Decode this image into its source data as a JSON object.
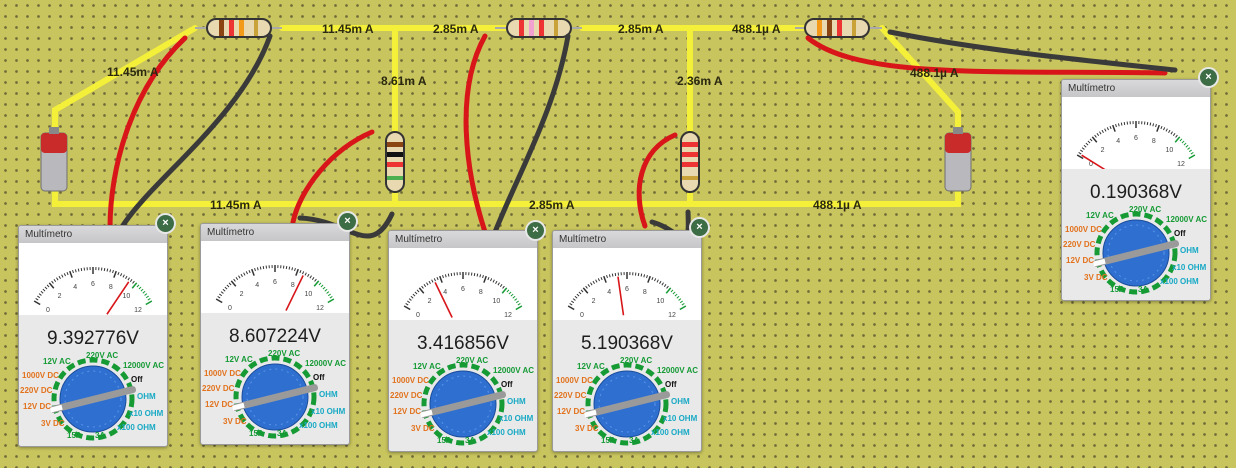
{
  "current_labels": [
    "11.45m A",
    "11.45m A",
    "8.61m A",
    "2.85m A",
    "2.85m A",
    "2.36m A",
    "488.1µ A",
    "488.1µ A",
    "11.45m A",
    "2.85m A",
    "488.1µ A"
  ],
  "meter": {
    "title": "Multímetro",
    "close_icon": "×",
    "scale_ticks": [
      "0",
      "2",
      "4",
      "6",
      "8",
      "10",
      "12"
    ],
    "range_labels": {
      "ac_12": "12V AC",
      "ac_220": "220V AC",
      "ac_12000": "12000V AC",
      "off": "Off",
      "ohm": "OHM",
      "ohm_x10": "x10 OHM",
      "ohm_x100": "x100 OHM",
      "dc_1000": "1000V DC",
      "dc_220": "220V DC",
      "dc_12": "12V DC",
      "dc_3": "3V DC",
      "a_15": "15A",
      "a_3": "3A"
    }
  },
  "meters": [
    {
      "reading": "9.392776V",
      "needle": 9.39
    },
    {
      "reading": "8.607224V",
      "needle": 8.61
    },
    {
      "reading": "3.416856V",
      "needle": 3.42
    },
    {
      "reading": "5.190368V",
      "needle": 5.19
    },
    {
      "reading": "0.190368V",
      "needle": 0.19
    }
  ],
  "colors": {
    "wire": "#f4f03a",
    "probe_positive": "#d8161a",
    "probe_negative": "#333333",
    "dial": "#2f6fd0",
    "ac_label": "#159a34",
    "dc_label": "#e2721c",
    "ohm_label": "#18a9c4"
  }
}
